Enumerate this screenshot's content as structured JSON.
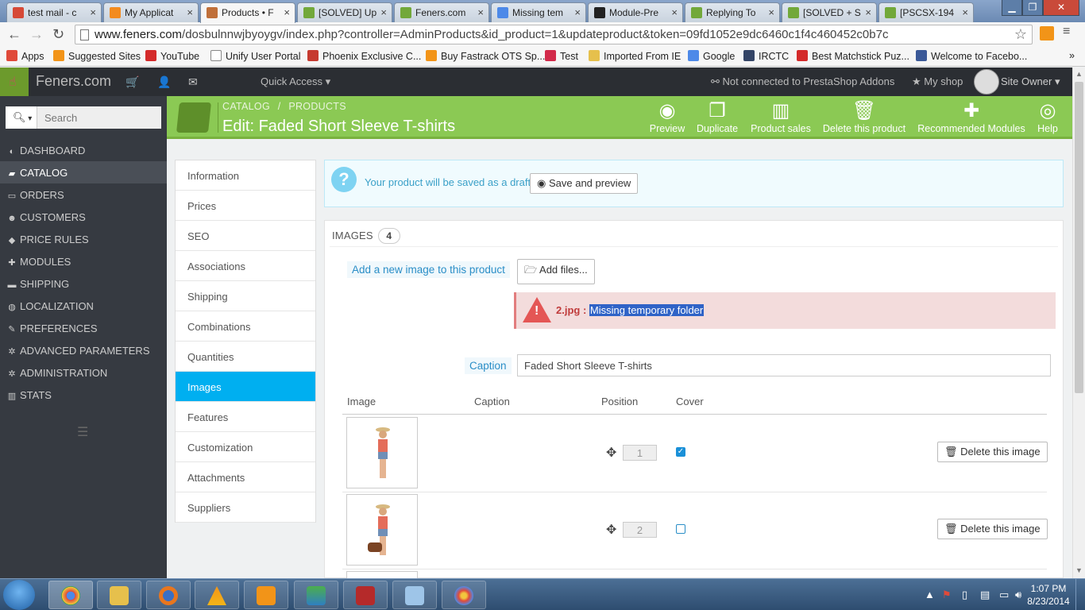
{
  "browser": {
    "tabs": [
      {
        "label": "test mail - c",
        "icon_color": "#d64937",
        "active": false
      },
      {
        "label": "My Applicat",
        "icon_color": "#f38b1f",
        "active": false
      },
      {
        "label": "Products • F",
        "icon_color": "#c0703a",
        "active": true
      },
      {
        "label": "[SOLVED] Up",
        "icon_color": "#72a83a",
        "active": false
      },
      {
        "label": "Feners.com",
        "icon_color": "#72a83a",
        "active": false
      },
      {
        "label": "Missing tem",
        "icon_color": "#4d89e8",
        "active": false
      },
      {
        "label": "Module-Pre",
        "icon_color": "#222222",
        "active": false
      },
      {
        "label": "Replying To",
        "icon_color": "#72a83a",
        "active": false
      },
      {
        "label": "[SOLVED + S",
        "icon_color": "#72a83a",
        "active": false
      },
      {
        "label": "[PSCSX-194",
        "icon_color": "#72a83a",
        "active": false
      }
    ],
    "url_host": "www.feners.com",
    "url_path": "/dosbulnnwjbyoygv/index.php?controller=AdminProducts&id_product=1&updateproduct&token=09fd1052e9dc6460c1f4c460452c0b7c",
    "bookmarks": [
      {
        "label": "Apps",
        "icon_color": "#e04a3a"
      },
      {
        "label": "Suggested Sites",
        "icon_color": "#f29418"
      },
      {
        "label": "YouTube",
        "icon_color": "#d42a2a"
      },
      {
        "label": "Unify User Portal",
        "icon_color": "#ffffff"
      },
      {
        "label": "Phoenix Exclusive C...",
        "icon_color": "#c63a2f"
      },
      {
        "label": "Buy Fastrack OTS Sp...",
        "icon_color": "#f29418"
      },
      {
        "label": "Test",
        "icon_color": "#d22a4a"
      },
      {
        "label": "Imported From IE",
        "icon_color": "#e6c04c"
      },
      {
        "label": "Google",
        "icon_color": "#4d89e8"
      },
      {
        "label": "IRCTC",
        "icon_color": "#334466"
      },
      {
        "label": "Best Matchstick Puz...",
        "icon_color": "#d42a2a"
      },
      {
        "label": "Welcome to Facebo...",
        "icon_color": "#3b5998"
      }
    ]
  },
  "header": {
    "brand": "Feners.com",
    "quick_access": "Quick Access",
    "addons": "Not connected to PrestaShop Addons",
    "my_shop": "My shop",
    "owner": "Site Owner"
  },
  "sidebar": {
    "search_placeholder": "Search",
    "items": [
      {
        "label": "DASHBOARD",
        "icon": "dashboard-icon",
        "glyph": "◐"
      },
      {
        "label": "CATALOG",
        "icon": "book-icon",
        "glyph": "▰"
      },
      {
        "label": "ORDERS",
        "icon": "credit-card-icon",
        "glyph": "▭"
      },
      {
        "label": "CUSTOMERS",
        "icon": "users-icon",
        "glyph": "☻"
      },
      {
        "label": "PRICE RULES",
        "icon": "tag-icon",
        "glyph": "◆"
      },
      {
        "label": "MODULES",
        "icon": "puzzle-icon",
        "glyph": "✚"
      },
      {
        "label": "SHIPPING",
        "icon": "truck-icon",
        "glyph": "▬"
      },
      {
        "label": "LOCALIZATION",
        "icon": "globe-icon",
        "glyph": "◍"
      },
      {
        "label": "PREFERENCES",
        "icon": "wrench-icon",
        "glyph": "✎"
      },
      {
        "label": "ADVANCED PARAMETERS",
        "icon": "cogs-icon",
        "glyph": "✲"
      },
      {
        "label": "ADMINISTRATION",
        "icon": "cog-icon",
        "glyph": "✲"
      },
      {
        "label": "STATS",
        "icon": "bar-chart-icon",
        "glyph": "▥"
      }
    ]
  },
  "page": {
    "breadcrumb_1": "CATALOG",
    "breadcrumb_sep": "/",
    "breadcrumb_2": "PRODUCTS",
    "title": "Edit: Faded Short Sleeve T-shirts",
    "toolbar": [
      {
        "label": "Preview",
        "icon": "eye-icon",
        "glyph": "◉"
      },
      {
        "label": "Duplicate",
        "icon": "copy-icon",
        "glyph": "❐"
      },
      {
        "label": "Product sales",
        "icon": "bar-chart-icon",
        "glyph": "▥"
      },
      {
        "label": "Delete this product",
        "icon": "trash-icon",
        "glyph": "🗑"
      },
      {
        "label": "Recommended Modules",
        "icon": "puzzle-icon",
        "glyph": "✚"
      },
      {
        "label": "Help",
        "icon": "lifebuoy-icon",
        "glyph": "◎"
      }
    ]
  },
  "product_tabs": [
    "Information",
    "Prices",
    "SEO",
    "Associations",
    "Shipping",
    "Combinations",
    "Quantities",
    "Images",
    "Features",
    "Customization",
    "Attachments",
    "Suppliers"
  ],
  "draft": {
    "text": "Your product will be saved as a draft.",
    "button": "Save and preview"
  },
  "images": {
    "title": "IMAGES",
    "count": "4",
    "add_label": "Add a new image to this product",
    "add_button": "Add files...",
    "error_file": "2.jpg :",
    "error_msg": "Missing temporary folder",
    "caption_label": "Caption",
    "caption_value": "Faded Short Sleeve T-shirts",
    "columns": [
      "Image",
      "Caption",
      "Position",
      "Cover"
    ],
    "rows": [
      {
        "position": "1",
        "cover": true,
        "delete": "Delete this image"
      },
      {
        "position": "2",
        "cover": false,
        "delete": "Delete this image"
      }
    ]
  },
  "taskbar": {
    "time": "1:07 PM",
    "date": "8/23/2014"
  }
}
